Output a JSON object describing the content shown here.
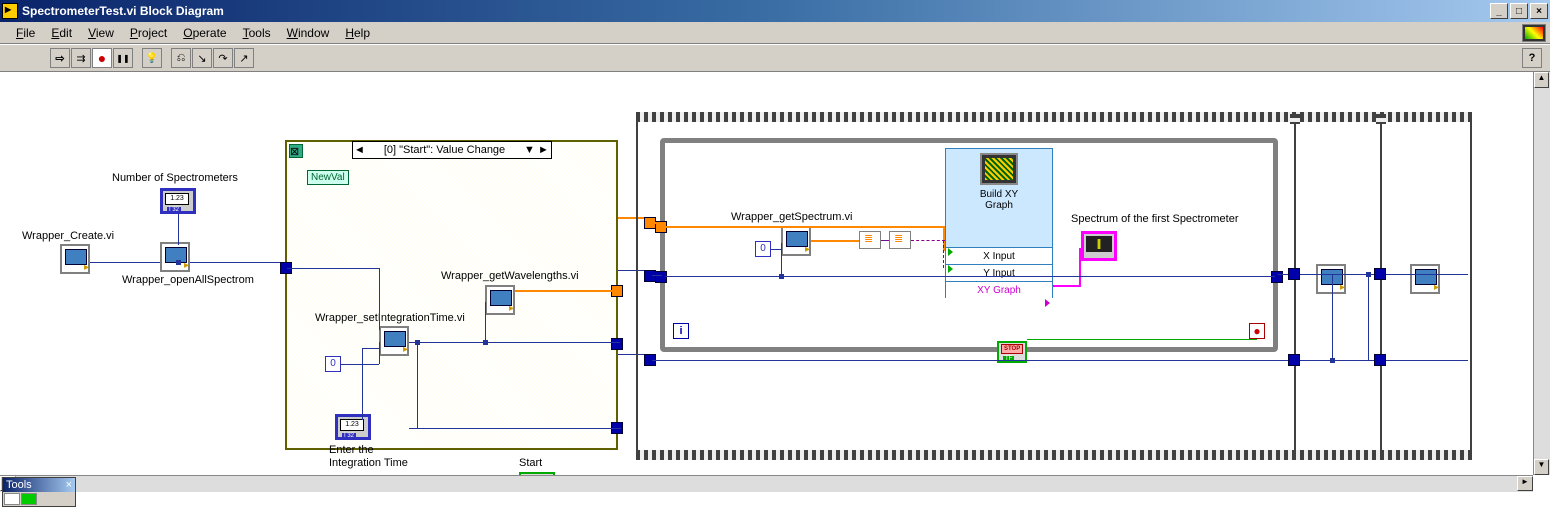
{
  "window": {
    "title": "SpectrometerTest.vi Block Diagram"
  },
  "menu": {
    "file": "File",
    "edit": "Edit",
    "view": "View",
    "project": "Project",
    "operate": "Operate",
    "tools": "Tools",
    "window": "Window",
    "help": "Help"
  },
  "tools_palette": {
    "title": "Tools"
  },
  "nodes": {
    "wrapper_create": "Wrapper_Create.vi",
    "num_spectrometers": "Number of Spectrometers",
    "wrapper_open_all": "Wrapper_openAllSpectrom",
    "wrapper_set_integration": "Wrapper_setIntegrationTime.vi",
    "wrapper_get_wavelengths": "Wrapper_getWavelengths.vi",
    "wrapper_get_spectrum": "Wrapper_getSpectrum.vi",
    "enter_integration_time_1": "Enter the",
    "enter_integration_time_2": "Integration Time",
    "start": "Start",
    "spectrum_label": "Spectrum of the first Spectrometer",
    "event_case": "[0] \"Start\": Value Change",
    "newval": "NewVal",
    "const_zero_a": "0",
    "const_zero_b": "0",
    "loop_i": "i",
    "indicator_val": "1.23",
    "indicator_tag": "I 32"
  },
  "express_xy": {
    "title1": "Build XY",
    "title2": "Graph",
    "x_input": "X Input",
    "y_input": "Y Input",
    "xy_graph": "XY Graph"
  }
}
